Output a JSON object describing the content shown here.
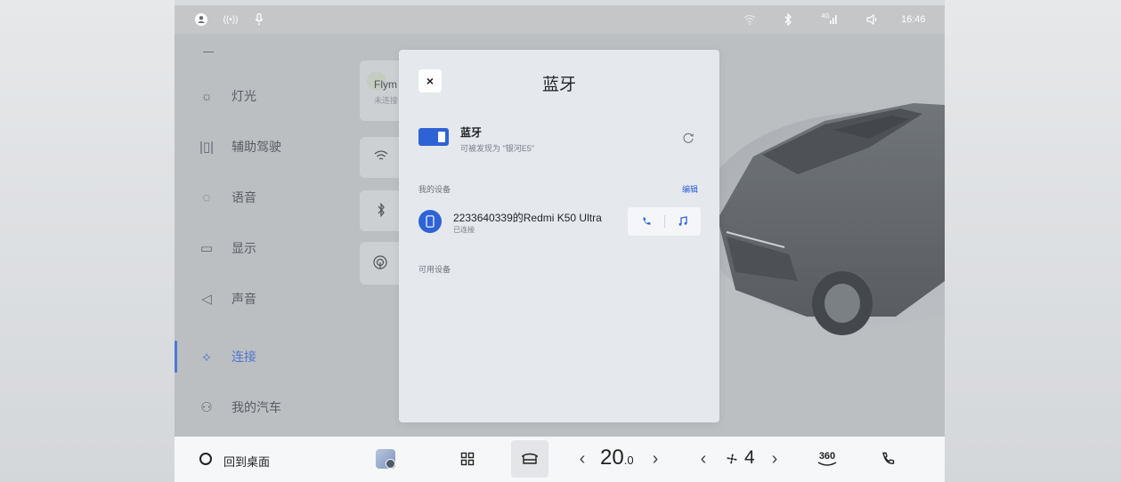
{
  "status_bar": {
    "time": "16:46",
    "left_icons": [
      "user-icon",
      "hotspot-icon",
      "microphone-icon"
    ],
    "hotspot_text": "((•))",
    "right_icons": [
      "wifi-icon",
      "bluetooth-icon",
      "cellular-signal-icon",
      "volume-icon"
    ],
    "cellular_text": "4G"
  },
  "nav": {
    "items": [
      {
        "label": "灯光",
        "icon": "light-icon",
        "glyph": "☼"
      },
      {
        "label": "辅助驾驶",
        "icon": "assist-driving-icon",
        "glyph": "|▯|"
      },
      {
        "label": "语音",
        "icon": "voice-icon",
        "glyph": "◌"
      },
      {
        "label": "显示",
        "icon": "display-icon",
        "glyph": "▭"
      },
      {
        "label": "声音",
        "icon": "sound-icon",
        "glyph": "◁"
      },
      {
        "label": "连接",
        "icon": "connect-icon",
        "glyph": "⟡",
        "active": true
      },
      {
        "label": "我的汽车",
        "icon": "my-car-icon",
        "glyph": "⚇"
      }
    ]
  },
  "background_card": {
    "title": "Flym",
    "subtitle": "未连接"
  },
  "modal": {
    "title": "蓝牙",
    "close_label": "×",
    "bluetooth": {
      "name": "蓝牙",
      "discoverable_text": "可被发现为 \"银河E5\"",
      "enabled": true
    },
    "my_devices_label": "我的设备",
    "edit_label": "编辑",
    "devices": [
      {
        "name": "2233640339的Redmi K50 Ultra",
        "status": "已连接",
        "actions": [
          "phone-icon",
          "music-icon"
        ]
      }
    ],
    "available_devices_label": "可用设备"
  },
  "dock": {
    "home_label": "回到桌面",
    "temperature": "20",
    "temperature_decimal": ".0",
    "fan_level": "4",
    "view_360_label": "360",
    "prev_glyph": "‹",
    "next_glyph": "›",
    "colors": {
      "accent": "#2e63d6"
    }
  }
}
